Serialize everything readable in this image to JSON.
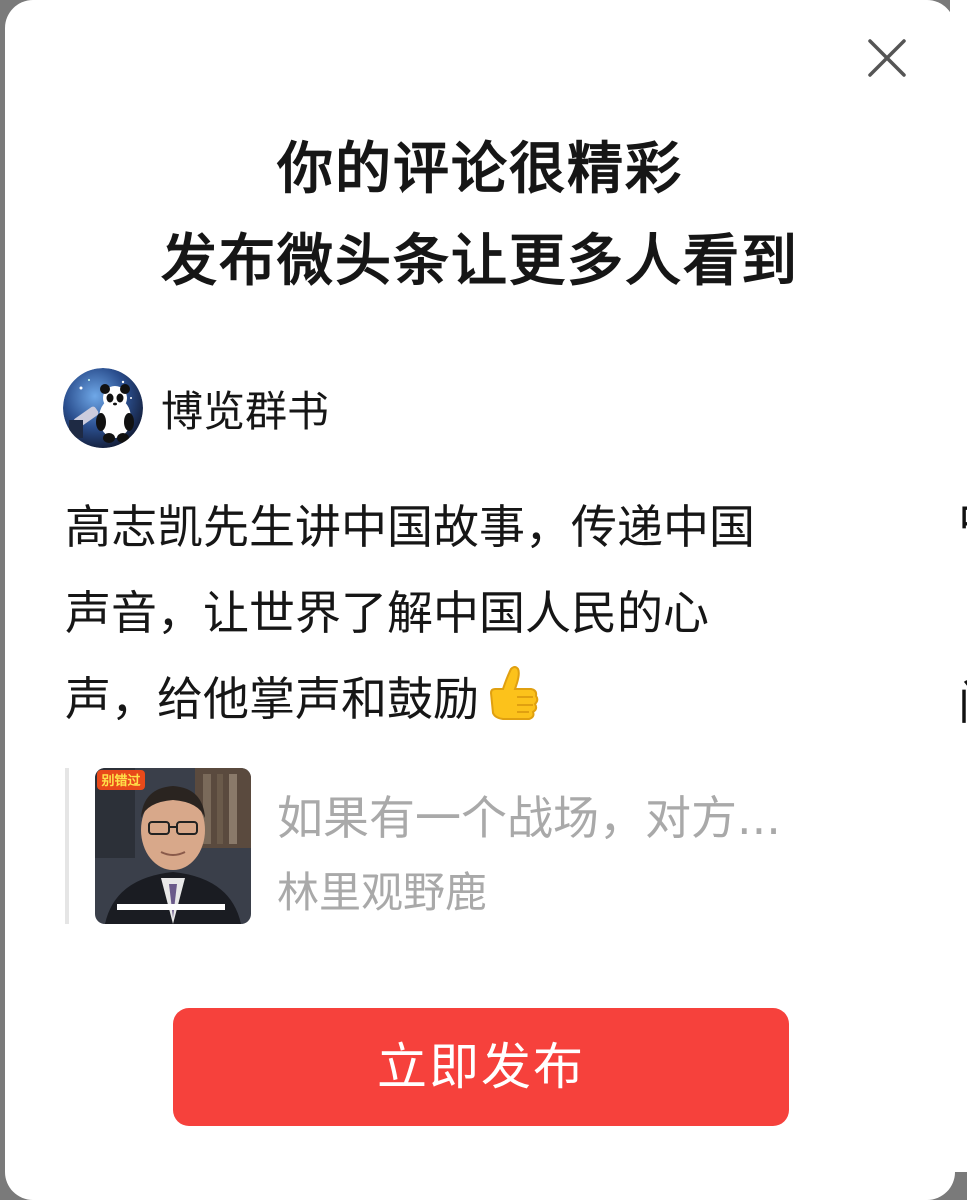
{
  "dialog": {
    "title_line1": "你的评论很精彩",
    "title_line2": "发布微头条让更多人看到",
    "close_icon": "close-icon"
  },
  "author": {
    "name": "博览群书",
    "avatar_icon": "panda-avatar"
  },
  "comment": {
    "line1": "高志凯先生讲中国故事，传递中国",
    "line2": "声音，让世界了解中国人民的心",
    "line3": "声，给他掌声和鼓励",
    "emoji": "thumbs-up-emoji"
  },
  "quoted_post": {
    "title": "如果有一个战场，对方...",
    "author": "林里观野鹿",
    "thumbnail_badge": "别错过"
  },
  "actions": {
    "publish_label": "立即发布"
  },
  "colors": {
    "accent": "#f6413c",
    "text": "#161616",
    "muted": "#a9a9a9"
  }
}
